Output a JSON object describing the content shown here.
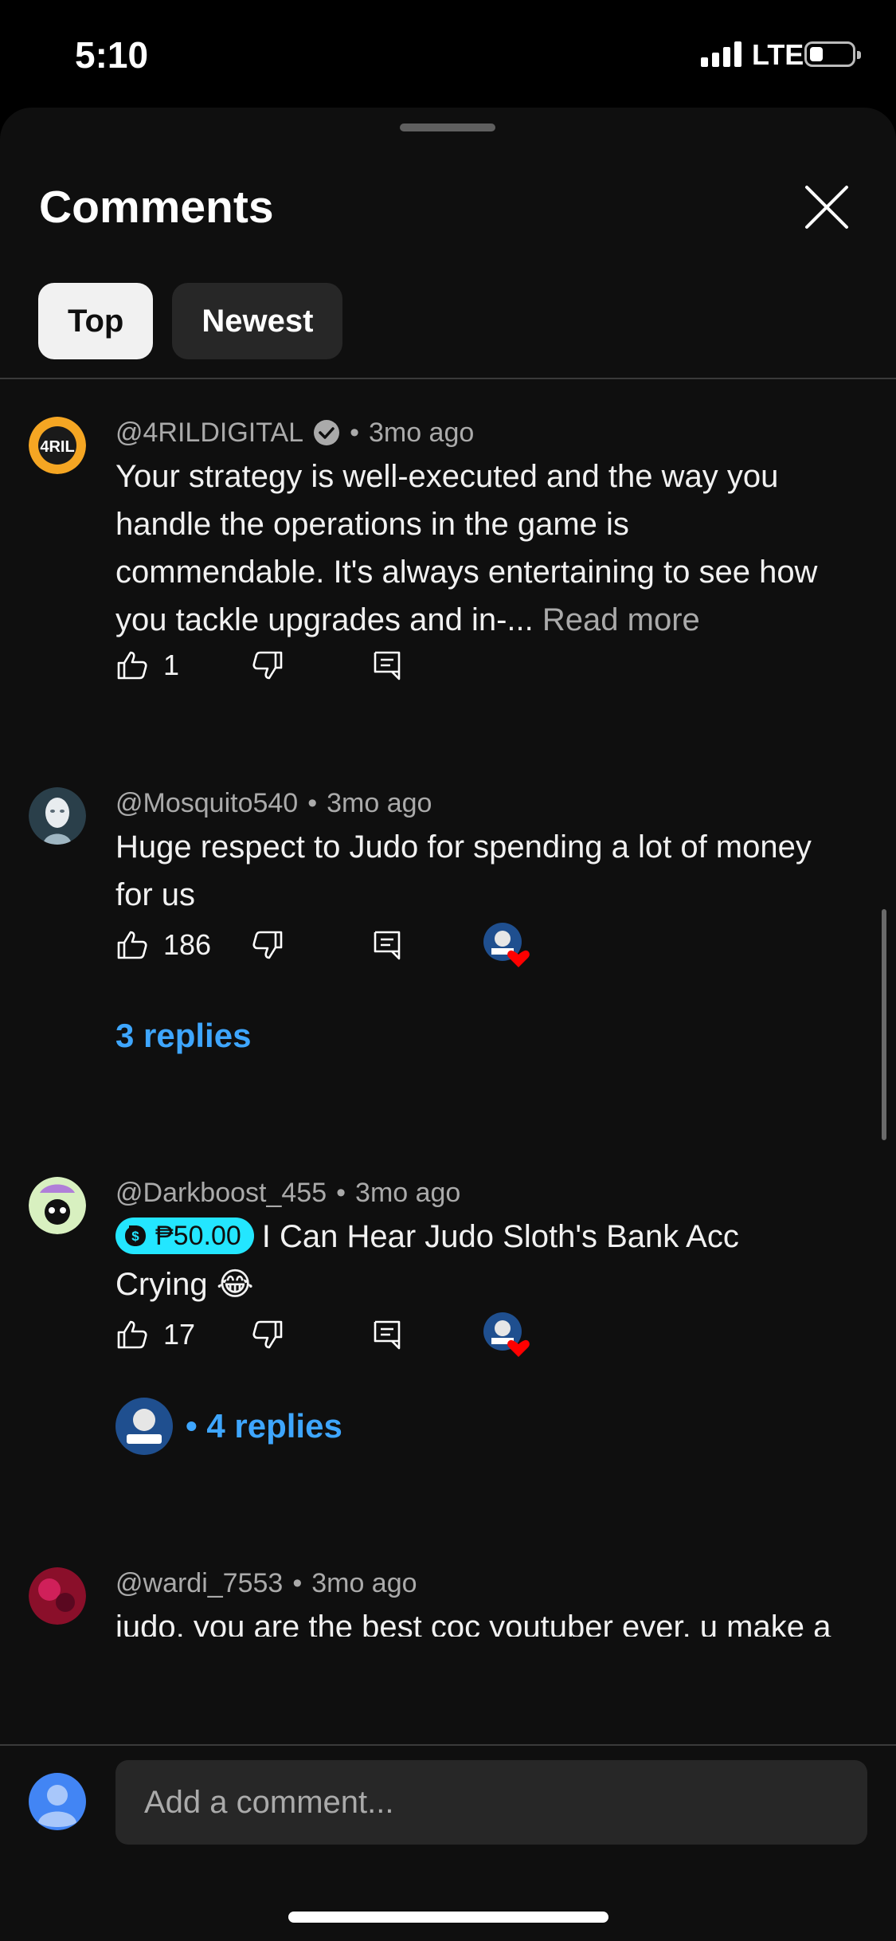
{
  "status_bar": {
    "time": "5:10",
    "network": "LTE"
  },
  "sheet": {
    "title": "Comments",
    "tabs": [
      {
        "label": "Top",
        "active": true
      },
      {
        "label": "Newest",
        "active": false
      }
    ]
  },
  "comments": [
    {
      "author": "@4RILDIGITAL",
      "verified": true,
      "separator": "•",
      "age": "3mo ago",
      "text": "Your strategy is well-executed and the way you handle the operations in the game is commendable. It's always entertaining to see how you tackle upgrades and in-...",
      "read_more": "Read more",
      "likes": "1",
      "avatar_text": "4RIL"
    },
    {
      "author": "@Mosquito540",
      "separator": "•",
      "age": "3mo ago",
      "text": "Huge respect to Judo for spending a lot of money for us",
      "likes": "186",
      "hearted": true,
      "replies": "3 replies"
    },
    {
      "author": "@Darkboost_455",
      "separator": "•",
      "age": "3mo ago",
      "super_thanks": "₱50.00",
      "text": "I Can Hear Judo Sloth's Bank Acc Crying 😂",
      "likes": "17",
      "hearted": true,
      "replies": "• 4 replies"
    },
    {
      "author": "@wardi_7553",
      "separator": "•",
      "age": "3mo ago",
      "text": "judo, you are the best coc youtuber ever. u make a high quality content and much care about the videos and us. hopefully u can see"
    }
  ],
  "composer": {
    "placeholder": "Add a comment..."
  },
  "icons": [
    "thumbs-up-icon",
    "thumbs-down-icon",
    "reply-icon",
    "creator-heart-icon",
    "close-icon",
    "verified-check-icon"
  ],
  "colors": {
    "background": "#0f0f0f",
    "accent_link": "#3ea6ff",
    "super_thanks": "#23e6ff",
    "chip_active": "#f1f1f1",
    "chip_inactive": "#272727",
    "heart": "#ff0000"
  }
}
